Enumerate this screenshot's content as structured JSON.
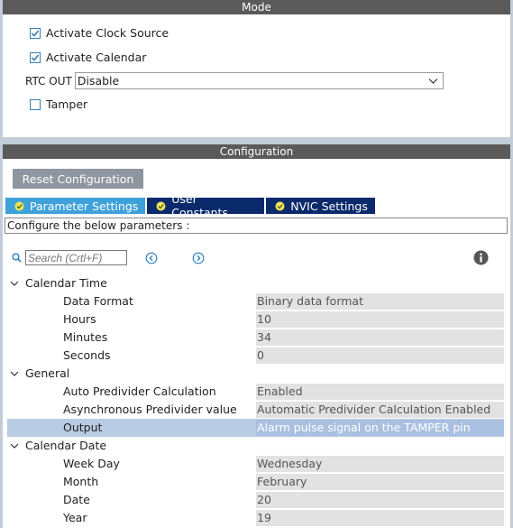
{
  "mode": {
    "header": "Mode",
    "activate_clock_source": {
      "label": "Activate Clock Source",
      "checked": true
    },
    "activate_calendar": {
      "label": "Activate Calendar",
      "checked": true
    },
    "rtc_out": {
      "label": "RTC OUT",
      "value": "Disable"
    },
    "tamper": {
      "label": "Tamper",
      "checked": false
    }
  },
  "configuration": {
    "header": "Configuration",
    "reset_label": "Reset Configuration",
    "tabs": [
      {
        "label": "Parameter Settings",
        "active": true
      },
      {
        "label": "User Constants",
        "active": false
      },
      {
        "label": "NVIC Settings",
        "active": false
      }
    ],
    "info_text": "Configure the below parameters :",
    "search_placeholder": "Search (Crtl+F)"
  },
  "parameters": {
    "calendar_time": {
      "label": "Calendar Time",
      "items": [
        {
          "name": "Data Format",
          "value": "Binary data format"
        },
        {
          "name": "Hours",
          "value": "10"
        },
        {
          "name": "Minutes",
          "value": "34"
        },
        {
          "name": "Seconds",
          "value": "0"
        }
      ]
    },
    "general": {
      "label": "General",
      "items": [
        {
          "name": "Auto Predivider Calculation",
          "value": "Enabled"
        },
        {
          "name": "Asynchronous Predivider value",
          "value": "Automatic Predivider Calculation Enabled"
        },
        {
          "name": "Output",
          "value": "Alarm pulse signal on the TAMPER pin"
        }
      ]
    },
    "calendar_date": {
      "label": "Calendar Date",
      "items": [
        {
          "name": "Week Day",
          "value": "Wednesday"
        },
        {
          "name": "Month",
          "value": "February"
        },
        {
          "name": "Date",
          "value": "20"
        },
        {
          "name": "Year",
          "value": "19"
        }
      ]
    }
  },
  "colors": {
    "header_bg": "#5a5a5a",
    "tab_active": "#3fa1d9",
    "tab_inactive": "#0b2a6b",
    "selected_row": "#b8cce4",
    "checkbox_accent": "#3a7fb0"
  }
}
